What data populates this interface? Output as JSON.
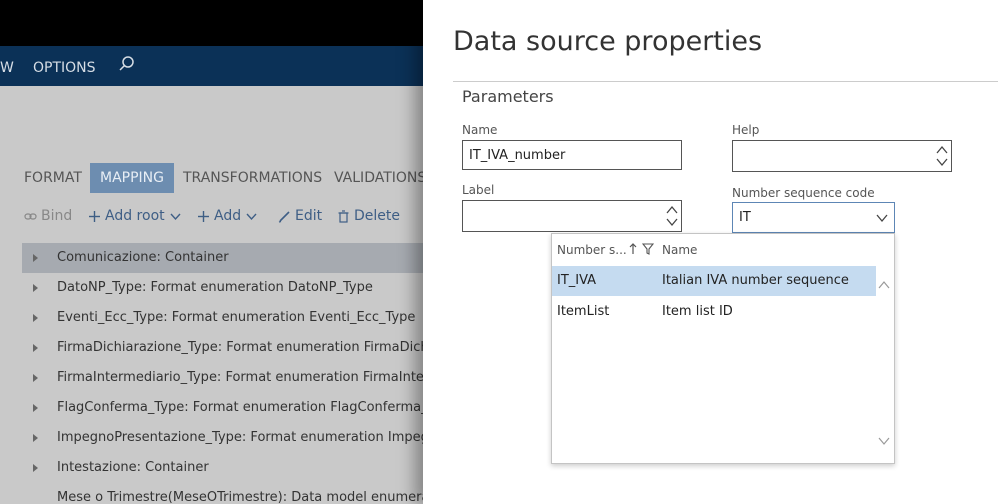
{
  "background_app": {
    "nav": {
      "partial_item": "W",
      "options_label": "OPTIONS"
    },
    "tabs": [
      {
        "label": "FORMAT",
        "active": false
      },
      {
        "label": "MAPPING",
        "active": true
      },
      {
        "label": "TRANSFORMATIONS",
        "active": false
      },
      {
        "label": "VALIDATIONS",
        "active": false
      }
    ],
    "toolbar": {
      "bind": "Bind",
      "add_root": "Add root",
      "add": "Add",
      "edit": "Edit",
      "delete": "Delete"
    },
    "tree_rows": [
      "Comunicazione: Container",
      "DatoNP_Type: Format enumeration DatoNP_Type",
      "Eventi_Ecc_Type: Format enumeration Eventi_Ecc_Type",
      "FirmaDichiarazione_Type: Format enumeration FirmaDichiarazione_Type",
      "FirmaIntermediario_Type: Format enumeration FirmaIntermediario_Type",
      "FlagConferma_Type: Format enumeration FlagConferma_Type",
      "ImpegnoPresentazione_Type: Format enumeration ImpegnoPresentazione_Type",
      "Intestazione: Container",
      "Mese o Trimestre(MeseOTrimestre): Data model enumeration"
    ]
  },
  "panel": {
    "title": "Data source properties",
    "section": "Parameters",
    "name_label": "Name",
    "name_value": "IT_IVA_number",
    "help_label": "Help",
    "help_value": "",
    "label_label": "Label",
    "label_value": "",
    "nsc_label": "Number sequence code",
    "nsc_value": "IT"
  },
  "dropdown": {
    "col1": "Number s...",
    "col2": "Name",
    "rows": [
      {
        "code": "IT_IVA",
        "name": "Italian IVA number sequence",
        "selected": true
      },
      {
        "code": "ItemList",
        "name": "Item list ID",
        "selected": false
      }
    ]
  },
  "colors": {
    "nav_bg": "#0b3157",
    "active_tab": "#6d8db0",
    "selected_row": "#c5dbf0",
    "link": "#3e5e85"
  }
}
